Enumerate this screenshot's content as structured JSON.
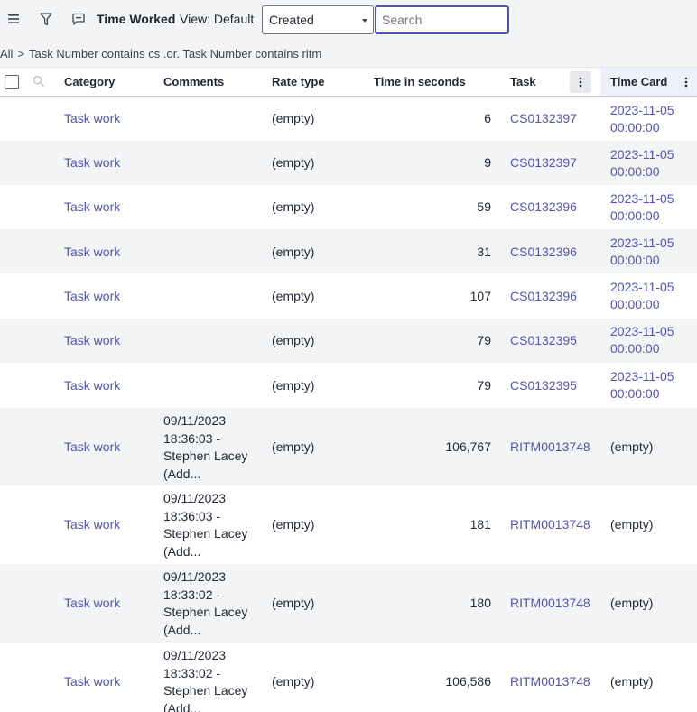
{
  "header": {
    "list_title": "Time Worked",
    "view_label": "View: Default",
    "field_select": "Created",
    "search_placeholder": "Search"
  },
  "breadcrumb": {
    "all": "All",
    "separator": ">",
    "filter": "Task Number contains cs .or. Task Number contains ritm"
  },
  "columns": {
    "category": "Category",
    "comments": "Comments",
    "rate_type": "Rate type",
    "time_in_seconds": "Time in seconds",
    "task": "Task",
    "time_card": "Time Card"
  },
  "colors": {
    "link": "#4f52bd",
    "row_alt": "#f3f4f6",
    "active_header": "#eef0fb"
  },
  "rows": [
    {
      "category": "Task work",
      "comments": "",
      "rate_type": "(empty)",
      "seconds": "6",
      "task": "CS0132397",
      "time_card_date": "2023-11-05",
      "time_card_time": "00:00:00"
    },
    {
      "category": "Task work",
      "comments": "",
      "rate_type": "(empty)",
      "seconds": "9",
      "task": "CS0132397",
      "time_card_date": "2023-11-05",
      "time_card_time": "00:00:00"
    },
    {
      "category": "Task work",
      "comments": "",
      "rate_type": "(empty)",
      "seconds": "59",
      "task": "CS0132396",
      "time_card_date": "2023-11-05",
      "time_card_time": "00:00:00"
    },
    {
      "category": "Task work",
      "comments": "",
      "rate_type": "(empty)",
      "seconds": "31",
      "task": "CS0132396",
      "time_card_date": "2023-11-05",
      "time_card_time": "00:00:00"
    },
    {
      "category": "Task work",
      "comments": "",
      "rate_type": "(empty)",
      "seconds": "107",
      "task": "CS0132396",
      "time_card_date": "2023-11-05",
      "time_card_time": "00:00:00"
    },
    {
      "category": "Task work",
      "comments": "",
      "rate_type": "(empty)",
      "seconds": "79",
      "task": "CS0132395",
      "time_card_date": "2023-11-05",
      "time_card_time": "00:00:00"
    },
    {
      "category": "Task work",
      "comments": "",
      "rate_type": "(empty)",
      "seconds": "79",
      "task": "CS0132395",
      "time_card_date": "2023-11-05",
      "time_card_time": "00:00:00"
    },
    {
      "category": "Task work",
      "comments_lines": [
        "09/11/2023",
        "18:36:03 -",
        "Stephen Lacey",
        "(Add..."
      ],
      "rate_type": "(empty)",
      "seconds": "106,767",
      "task": "RITM0013748",
      "time_card_empty": "(empty)"
    },
    {
      "category": "Task work",
      "comments_lines": [
        "09/11/2023",
        "18:36:03 -",
        "Stephen Lacey",
        "(Add..."
      ],
      "rate_type": "(empty)",
      "seconds": "181",
      "task": "RITM0013748",
      "time_card_empty": "(empty)"
    },
    {
      "category": "Task work",
      "comments_lines": [
        "09/11/2023",
        "18:33:02 -",
        "Stephen Lacey",
        "(Add..."
      ],
      "rate_type": "(empty)",
      "seconds": "180",
      "task": "RITM0013748",
      "time_card_empty": "(empty)"
    },
    {
      "category": "Task work",
      "comments_lines": [
        "09/11/2023",
        "18:33:02 -",
        "Stephen Lacey",
        "(Add..."
      ],
      "rate_type": "(empty)",
      "seconds": "106,586",
      "task": "RITM0013748",
      "time_card_empty": "(empty)"
    }
  ]
}
